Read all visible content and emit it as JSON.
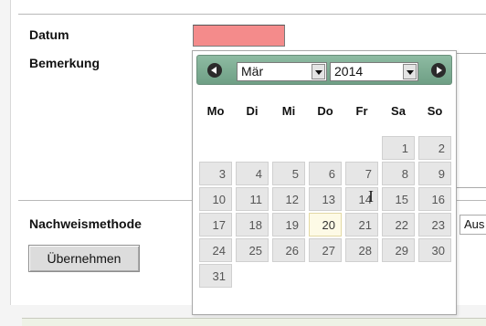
{
  "form": {
    "date_label": "Datum",
    "remark_label": "Bemerkung",
    "method_label": "Nachweismethode",
    "method_select_value": "Aus",
    "apply_button": "Übernehmen"
  },
  "datepicker": {
    "month": "Mär",
    "year": "2014",
    "weekdays": [
      "Mo",
      "Di",
      "Mi",
      "Do",
      "Fr",
      "Sa",
      "So"
    ],
    "weeks": [
      [
        "",
        "",
        "",
        "",
        "",
        "1",
        "2"
      ],
      [
        "3",
        "4",
        "5",
        "6",
        "7",
        "8",
        "9"
      ],
      [
        "10",
        "11",
        "12",
        "13",
        "14",
        "15",
        "16"
      ],
      [
        "17",
        "18",
        "19",
        "20",
        "21",
        "22",
        "23"
      ],
      [
        "24",
        "25",
        "26",
        "27",
        "28",
        "29",
        "30"
      ],
      [
        "31",
        "",
        "",
        "",
        "",
        "",
        ""
      ]
    ],
    "highlighted_day": "20"
  },
  "colors": {
    "invalid_field": "#f48b8b",
    "header_green": "#7fae93",
    "day_cell": "#e6e6e6",
    "today_cell": "#fdfae6"
  }
}
